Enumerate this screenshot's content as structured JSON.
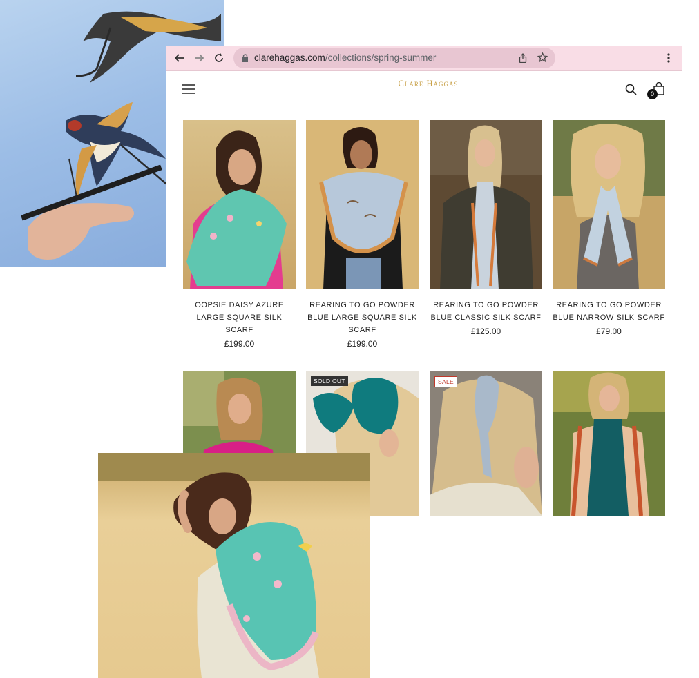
{
  "browser": {
    "url_domain": "clarehaggas.com",
    "url_path": "/collections/spring-summer"
  },
  "site": {
    "logo_text": "Clare Haggas",
    "cart_count": "0"
  },
  "products": [
    {
      "name": "OOPSIE DAISY AZURE LARGE SQUARE SILK SCARF",
      "price": "£199.00"
    },
    {
      "name": "REARING TO GO POWDER BLUE LARGE SQUARE SILK SCARF",
      "price": "£199.00"
    },
    {
      "name": "REARING TO GO POWDER BLUE CLASSIC SILK SCARF",
      "price": "£125.00"
    },
    {
      "name": "REARING TO GO POWDER BLUE NARROW SILK SCARF",
      "price": "£79.00"
    }
  ],
  "badges": {
    "sold_out": "SOLD OUT",
    "sale": "SALE"
  },
  "colors": {
    "toolbar": "#f9dde6",
    "logo_gold": "#c9a24a",
    "sale_red": "#c0392b"
  }
}
